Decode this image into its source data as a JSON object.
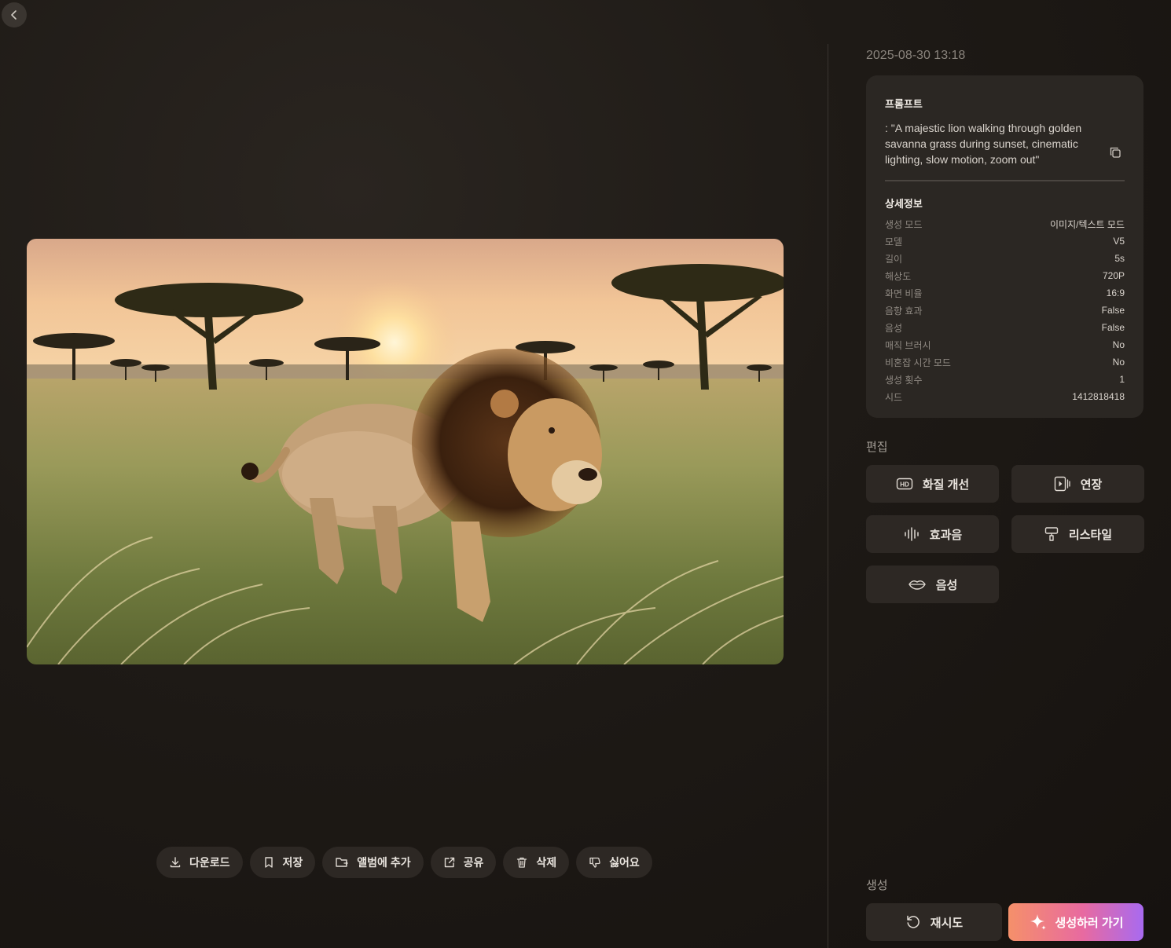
{
  "timestamp": "2025-08-30 13:18",
  "prompt": {
    "title": "프롬프트",
    "text": ": \"A majestic lion walking through golden savanna grass during sunset, cinematic lighting, slow motion, zoom out\""
  },
  "details": {
    "title": "상세정보",
    "rows": [
      {
        "key": "생성 모드",
        "value": "이미지/텍스트 모드"
      },
      {
        "key": "모델",
        "value": "V5"
      },
      {
        "key": "길이",
        "value": "5s"
      },
      {
        "key": "해상도",
        "value": "720P"
      },
      {
        "key": "화면 비율",
        "value": "16:9"
      },
      {
        "key": "음향 효과",
        "value": "False"
      },
      {
        "key": "음성",
        "value": "False"
      },
      {
        "key": "매직 브러시",
        "value": "No"
      },
      {
        "key": "비혼잡 시간 모드",
        "value": "No"
      },
      {
        "key": "생성 횟수",
        "value": "1"
      },
      {
        "key": "시드",
        "value": "1412818418"
      }
    ]
  },
  "edit": {
    "label": "편집",
    "buttons": {
      "enhance": "화질 개선",
      "extend": "연장",
      "sound": "효과음",
      "restyle": "리스타일",
      "voice": "음성"
    }
  },
  "generate": {
    "label": "생성",
    "retry": "재시도",
    "go": "생성하러 가기"
  },
  "actions": {
    "download": "다운로드",
    "save": "저장",
    "album": "앨범에 추가",
    "share": "공유",
    "delete": "삭제",
    "dislike": "싫어요"
  },
  "colors": {
    "background": "#1f1b17",
    "card": "#2b2723",
    "button": "#2d2824",
    "accent_start": "#f5906a",
    "accent_end": "#a86af0"
  }
}
